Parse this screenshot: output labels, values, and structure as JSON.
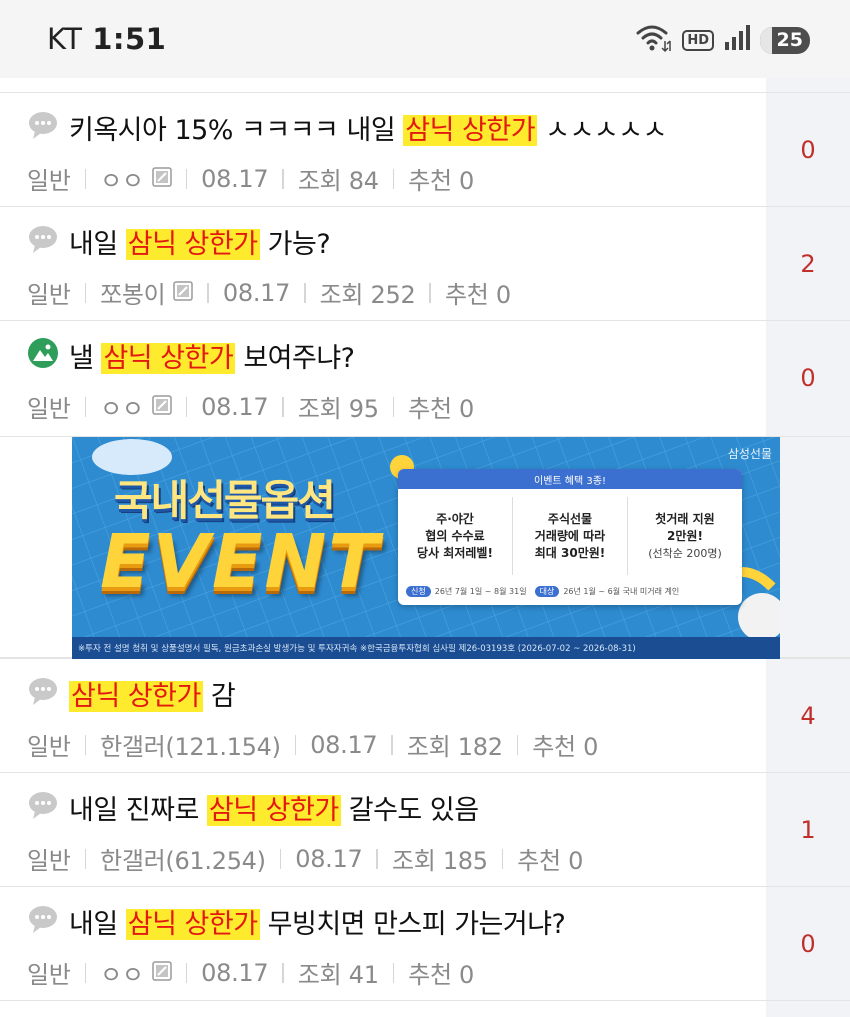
{
  "status_bar": {
    "carrier": "KT",
    "time": "1:51",
    "network_badge": "HD",
    "battery_level": "25"
  },
  "posts": [
    {
      "category_icon": "speech-bubble-icon",
      "title_pre": "키옥시아 15% ㅋㅋㅋㅋ 내일 ",
      "title_highlight": "삼닉 상한가",
      "title_post": " ㅅㅅㅅㅅㅅ",
      "category": "일반",
      "author": "ㅇㅇ",
      "date": "08.17",
      "views": "조회 84",
      "recommend": "추천 0",
      "comments": "0"
    },
    {
      "category_icon": "speech-bubble-icon",
      "title_pre": "내일 ",
      "title_highlight": "삼닉 상한가",
      "title_post": " 가능?",
      "category": "일반",
      "author": "쪼봉이",
      "date": "08.17",
      "views": "조회 252",
      "recommend": "추천 0",
      "comments": "2"
    },
    {
      "category_icon": "image-post-icon",
      "title_pre": "낼 ",
      "title_highlight": "삼닉 상한가",
      "title_post": " 보여주냐?",
      "category": "일반",
      "author": "ㅇㅇ",
      "date": "08.17",
      "views": "조회 95",
      "recommend": "추천 0",
      "comments": "0"
    },
    {
      "category_icon": "speech-bubble-icon",
      "title_pre": "",
      "title_highlight": "삼닉 상한가",
      "title_post": " 감",
      "category": "일반",
      "author": "한갤러(121.154)",
      "date": "08.17",
      "views": "조회 182",
      "recommend": "추천 0",
      "comments": "4"
    },
    {
      "category_icon": "speech-bubble-icon",
      "title_pre": "내일 진짜로 ",
      "title_highlight": "삼닉 상한가",
      "title_post": " 갈수도 있음",
      "category": "일반",
      "author": "한갤러(61.254)",
      "date": "08.17",
      "views": "조회 185",
      "recommend": "추천 0",
      "comments": "1"
    },
    {
      "category_icon": "speech-bubble-icon",
      "title_pre": "내일 ",
      "title_highlight": "삼닉 상한가",
      "title_post": " 무빙치면 만스피 가는거냐?",
      "category": "일반",
      "author": "ㅇㅇ",
      "date": "08.17",
      "views": "조회 41",
      "recommend": "추천 0",
      "comments": "0"
    }
  ],
  "ad": {
    "brand": "삼성선물",
    "headline": "국내선물옵션",
    "event_word": "EVENT",
    "card_header": "이벤트 혜택 3종!",
    "benefits": [
      {
        "line1": "주·야간",
        "line2": "협의 수수료",
        "line3": "당사 최저레벨!"
      },
      {
        "line1": "주식선물",
        "line2": "거래량에 따라",
        "line3": "최대 30만원!"
      },
      {
        "line1": "첫거래 지원",
        "line2": "2만원!",
        "line3": "(선착순 200명)"
      }
    ],
    "period_label": "신청",
    "period_text": "26년 7월 1일 ~ 8월 31일",
    "target_label": "대상",
    "target_text": "26년 1월 ~ 6월 국내 미거래 계인",
    "disclaimer": "※투자 전 설명 청취 및 상품설명서 필독, 원금초과손실 발생가능 및 투자자귀속 ※한국금융투자협회 심사필 제26-03193호 (2026-07-02 ~ 2026-08-31)"
  },
  "colors": {
    "highlight_bg": "#ffeb2e",
    "highlight_text": "#e3180f",
    "comment_count": "#c0302b",
    "meta_text": "#8a8a8a"
  }
}
